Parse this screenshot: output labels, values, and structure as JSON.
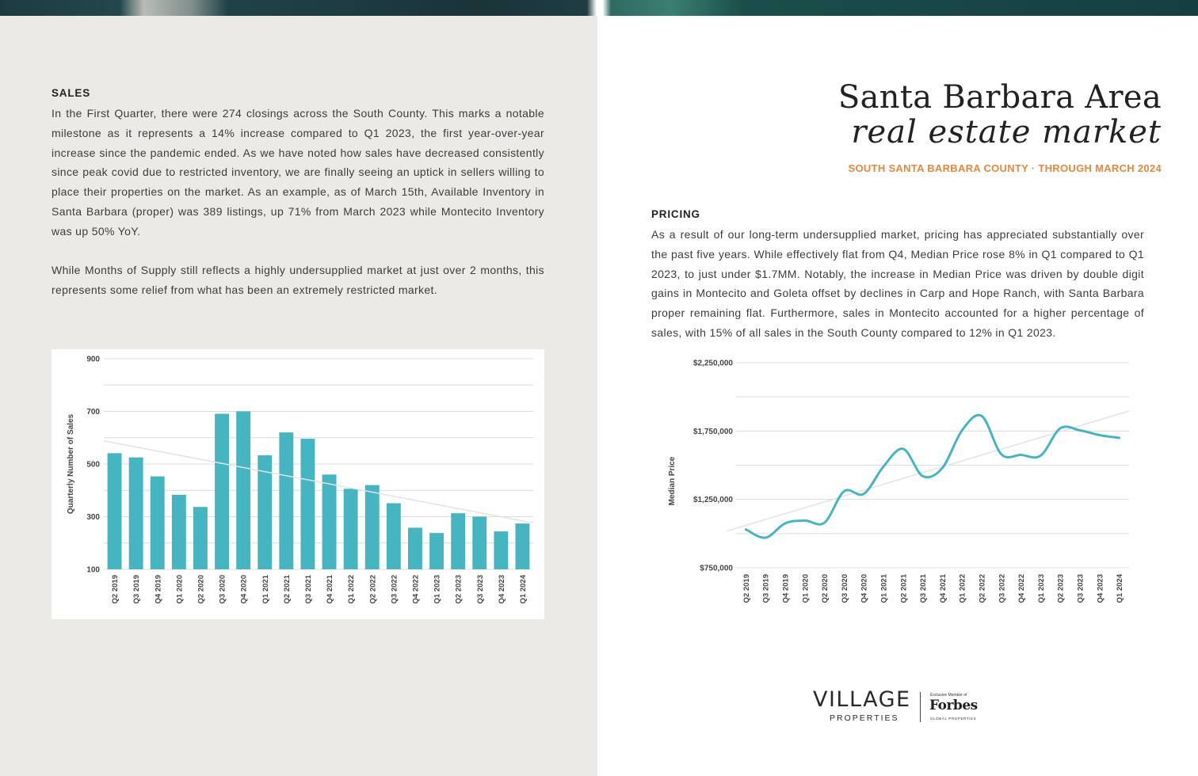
{
  "left": {
    "sales_heading": "SALES",
    "sales_p1": "In the First Quarter, there were 274 closings across the South County. This marks a notable milestone as it represents a 14% increase compared to Q1 2023, the first year-over-year increase since the pandemic ended. As we have noted how sales have decreased consistently since peak covid due to restricted inventory, we are finally seeing an uptick in sellers willing to place their properties on the market. As an example, as of March 15th, Available Inventory in Santa Barbara (proper) was 389 listings, up 71% from March 2023 while Montecito Inventory was up 50% YoY.",
    "sales_p2": "While Months of Supply still reflects a highly undersupplied market at just over 2 months, this represents some relief from what has been an extremely restricted market."
  },
  "right": {
    "title_line1": "Santa Barbara Area",
    "title_line2": "real estate market",
    "subtitle": "SOUTH SANTA BARBARA COUNTY · THROUGH MARCH 2024",
    "pricing_heading": "PRICING",
    "pricing_p1": "As a result of our long-term undersupplied market, pricing has appreciated substantially over the past five years. While effectively flat from Q4, Median Price rose 8% in Q1 compared to Q1 2023, to just under $1.7MM. Notably, the increase in Median Price was driven by double digit gains in Montecito and Goleta offset by declines in Carp and Hope Ranch, with Santa Barbara proper remaining flat. Furthermore, sales in Montecito accounted for a higher percentage of sales, with 15% of all sales in the South County compared to 12% in Q1 2023."
  },
  "logo": {
    "village": "VILLAGE",
    "properties": "PROPERTIES",
    "exclusive": "Exclusive Member of",
    "forbes": "Forbes",
    "global": "GLOBAL PROPERTIES"
  },
  "colors": {
    "accent": "#e9883c",
    "bar": "#45b6c1",
    "trend": "#e3e3e3",
    "grid": "#dcdcdc"
  },
  "chart_data": [
    {
      "type": "bar",
      "categories": [
        "Q2 2019",
        "Q3 2019",
        "Q4 2019",
        "Q1 2020",
        "Q2 2020",
        "Q3 2020",
        "Q4 2020",
        "Q1 2021",
        "Q2 2021",
        "Q3 2021",
        "Q4 2021",
        "Q1 2022",
        "Q2 2022",
        "Q3 2022",
        "Q4 2022",
        "Q1 2023",
        "Q2 2023",
        "Q3 2023",
        "Q4 2023",
        "Q1 2024"
      ],
      "values": [
        541,
        525,
        453,
        383,
        337,
        691,
        700,
        533,
        620,
        596,
        460,
        406,
        420,
        351,
        258,
        238,
        313,
        300,
        244,
        274
      ],
      "ylabel": "Quarterly Number of Sales",
      "ylim": [
        100,
        900
      ],
      "yticks": [
        100,
        300,
        500,
        700,
        900
      ],
      "yticks_labels": [
        "100",
        "300",
        "500",
        "700",
        "900"
      ],
      "trendline": true,
      "grid": true
    },
    {
      "type": "line",
      "x": [
        "Q2 2019",
        "Q3 2019",
        "Q4 2019",
        "Q1 2020",
        "Q2 2020",
        "Q3 2020",
        "Q4 2020",
        "Q1 2021",
        "Q2 2021",
        "Q3 2021",
        "Q4 2021",
        "Q1 2022",
        "Q2 2022",
        "Q3 2022",
        "Q4 2022",
        "Q1 2023",
        "Q2 2023",
        "Q3 2023",
        "Q4 2023",
        "Q1 2024"
      ],
      "values": [
        1030000,
        970000,
        1075000,
        1095000,
        1080000,
        1310000,
        1290000,
        1490000,
        1620000,
        1420000,
        1480000,
        1755000,
        1860000,
        1580000,
        1575000,
        1570000,
        1770000,
        1755000,
        1720000,
        1700000
      ],
      "ylabel": "Median Price",
      "ylim": [
        750000,
        2250000
      ],
      "yticks": [
        750000,
        1250000,
        1750000,
        2250000
      ],
      "yticks_labels": [
        "$750,000",
        "$1,250,000",
        "$1,750,000",
        "$2,250,000"
      ],
      "trendline": true,
      "grid": true
    }
  ]
}
